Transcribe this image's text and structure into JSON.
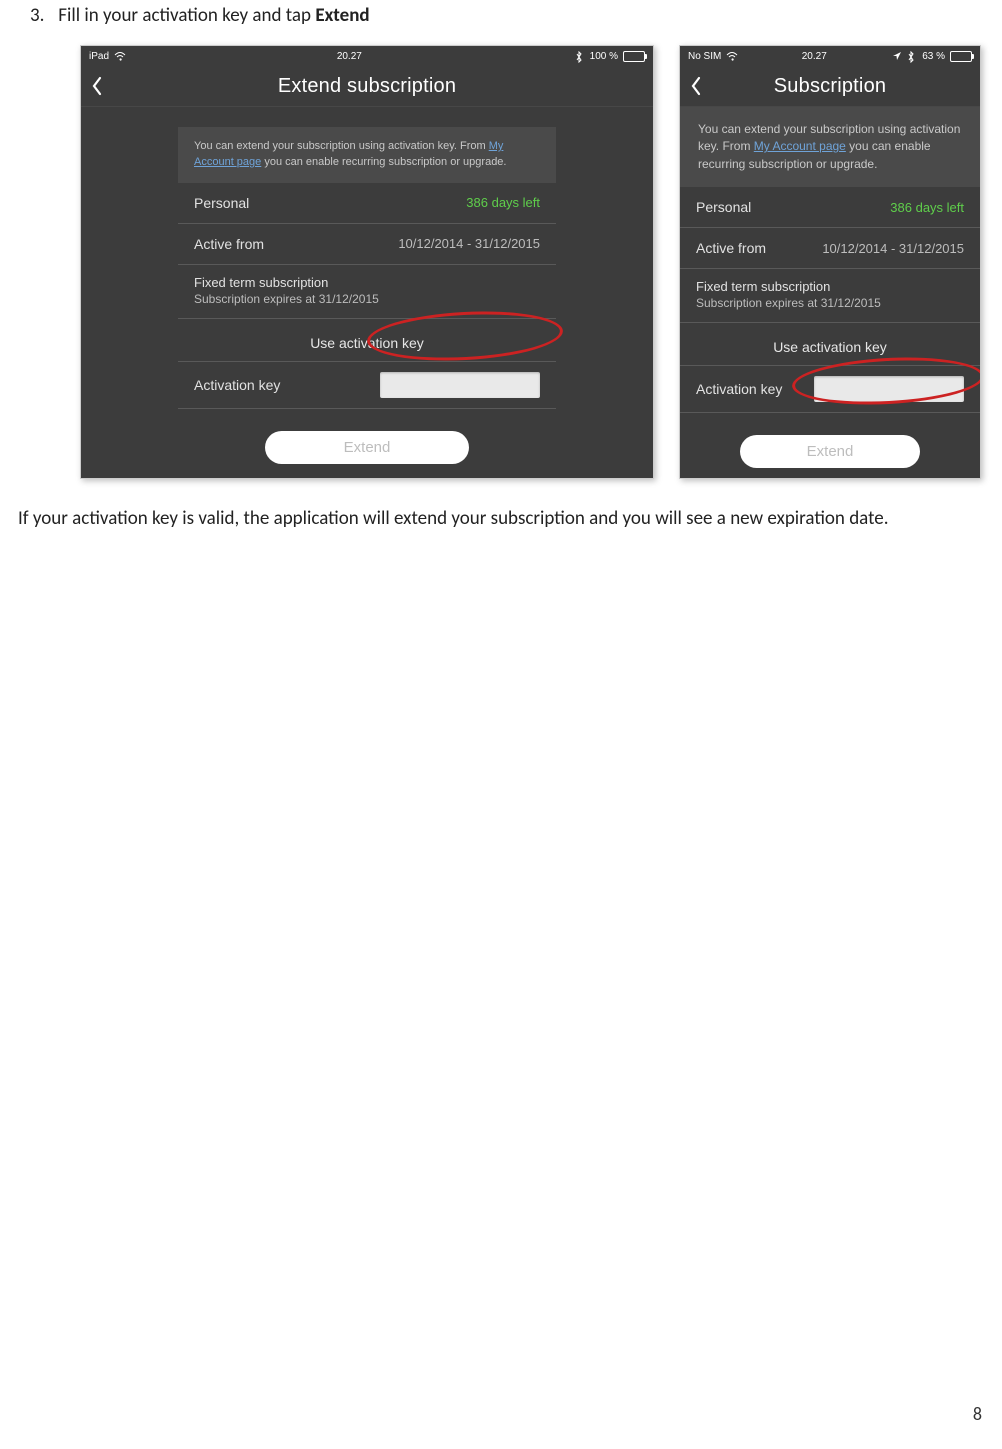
{
  "step": {
    "num": "3.",
    "text_prefix": "Fill in your activation key and tap ",
    "text_bold": "Extend"
  },
  "ipad": {
    "status": {
      "left": "iPad",
      "time": "20.27",
      "battery": "100 %"
    },
    "title": "Extend subscription",
    "info_prefix": "You can extend your subscription using activation key. From ",
    "info_link": "My Account page",
    "info_suffix": " you can enable recurring subscription or upgrade.",
    "plan_label": "Personal",
    "days_left": "386 days left",
    "active_label": "Active from",
    "active_range": "10/12/2014 - 31/12/2015",
    "fixed_l1": "Fixed term subscription",
    "fixed_l2": "Subscription expires at 31/12/2015",
    "section": "Use activation key",
    "act_label": "Activation key",
    "extend_label": "Extend"
  },
  "iphone": {
    "status": {
      "sim": "No SIM",
      "time": "20.27",
      "battery": "63 %"
    },
    "title": "Subscription",
    "info_prefix": "You can extend your subscription using activation key. From ",
    "info_link": "My Account page",
    "info_suffix": " you can enable recurring subscription or upgrade.",
    "plan_label": "Personal",
    "days_left": "386 days left",
    "active_label": "Active from",
    "active_range": "10/12/2014 - 31/12/2015",
    "fixed_l1": "Fixed term subscription",
    "fixed_l2": "Subscription expires at 31/12/2015",
    "section": "Use activation key",
    "act_label": "Activation key",
    "extend_label": "Extend"
  },
  "para": "If your activation key is valid, the application will extend your subscription and you will see a new expiration date.",
  "page_number": "8"
}
